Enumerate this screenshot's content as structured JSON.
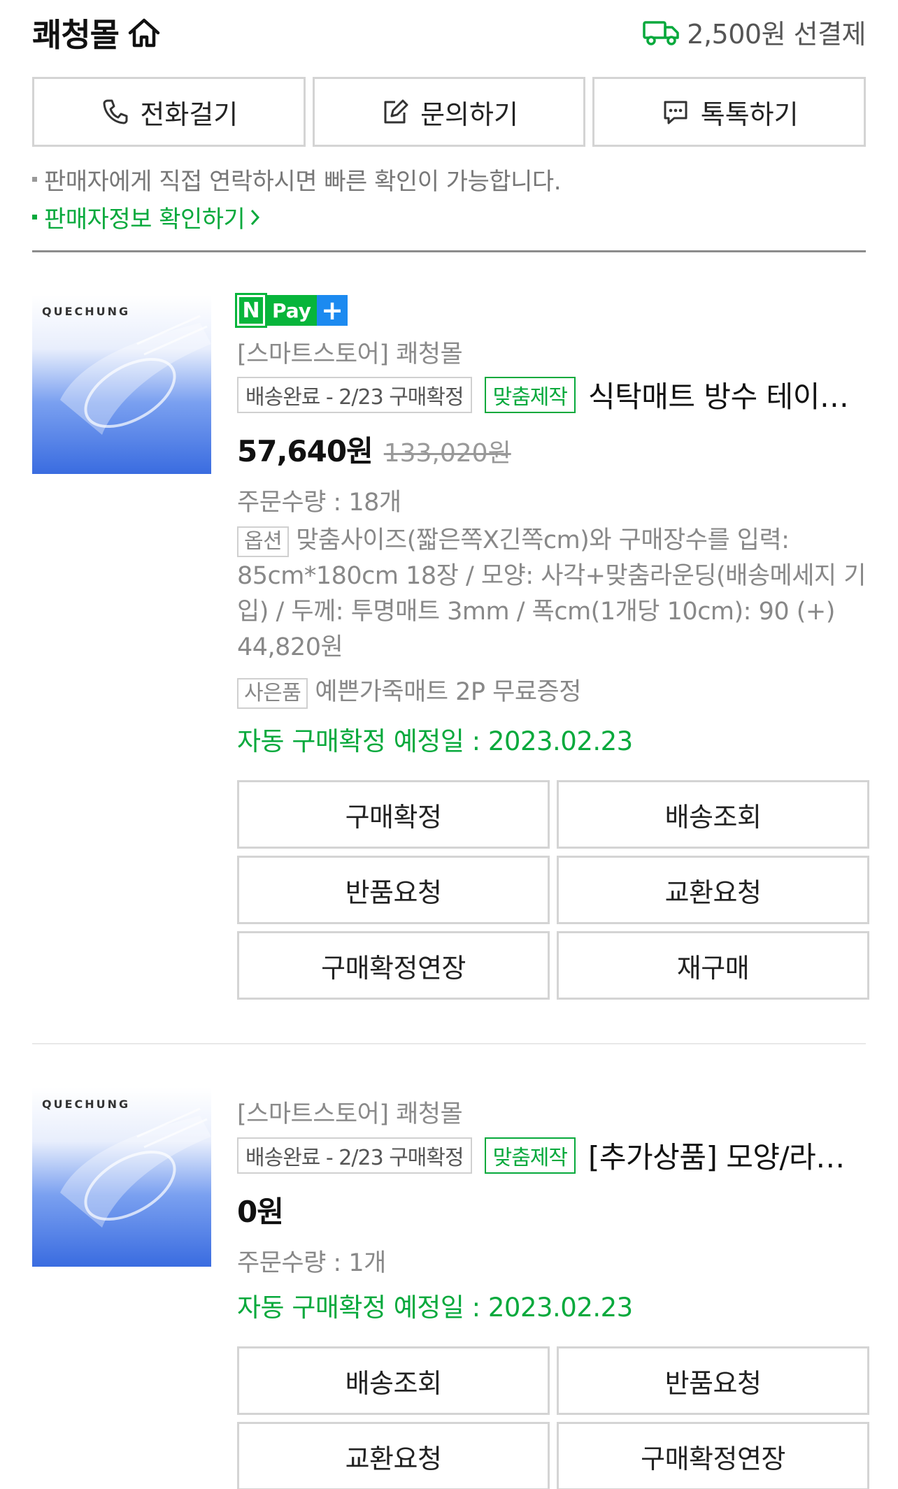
{
  "header": {
    "store_name": "쾌청몰",
    "shipping_text": "2,500원 선결제"
  },
  "contact": {
    "call": "전화걸기",
    "inquiry": "문의하기",
    "talk": "톡톡하기"
  },
  "notices": {
    "direct_contact": "판매자에게 직접 연락하시면 빠른 확인이 가능합니다.",
    "seller_info_link": "판매자정보 확인하기"
  },
  "products": [
    {
      "thumb_brand": "QUECHUNG",
      "npay": {
        "n": "N",
        "pay": "Pay",
        "plus": "+"
      },
      "seller": "[스마트스토어] 쾌청몰",
      "status_tag": "배송완료 - 2/23 구매확정",
      "custom_tag": "맞춤제작",
      "title": "식탁매트 방수 테이블매트 투명 식탁보 주문제작",
      "price": "57,640원",
      "original_price": "133,020원",
      "quantity": "주문수량 : 18개",
      "option_label": "옵션",
      "option_text": "맞춤사이즈(짧은쪽X긴쪽cm)와 구매장수를 입력: 85cm*180cm 18장 / 모양: 사각+맞춤라운딩(배송메세지 기입) / 두께: 투명매트 3mm / 폭cm(1개당 10cm): 90 (+) 44,820원",
      "gift_label": "사은품",
      "gift_text": "예쁜가죽매트 2P 무료증정",
      "auto_confirm": "자동 구매확정 예정일 : 2023.02.23",
      "buttons": [
        "구매확정",
        "배송조회",
        "반품요청",
        "교환요청",
        "구매확정연장",
        "재구매"
      ]
    },
    {
      "thumb_brand": "QUECHUNG",
      "seller": "[스마트스토어] 쾌청몰",
      "status_tag": "배송완료 - 2/23 구매확정",
      "custom_tag": "맞춤제작",
      "title": "[추가상품] 모양/라운딩 가공",
      "price": "0원",
      "quantity": "주문수량 : 1개",
      "auto_confirm": "자동 구매확정 예정일 : 2023.02.23",
      "buttons": [
        "배송조회",
        "반품요청",
        "교환요청",
        "구매확정연장"
      ]
    }
  ],
  "colors": {
    "accent_green": "#07a93c",
    "npay_green": "#07b53b",
    "npay_blue": "#1c8af0",
    "border_gray": "#d4d4d4"
  }
}
